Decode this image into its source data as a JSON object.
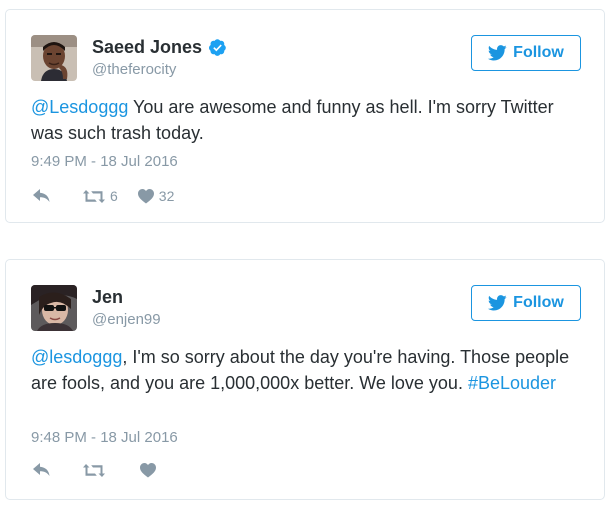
{
  "colors": {
    "link": "#1b95e0",
    "meta": "#8899a6",
    "text": "#292f33",
    "border": "#e1e8ed",
    "verified": "#1da1f2"
  },
  "follow_label": "Follow",
  "tweets": [
    {
      "display_name": "Saeed Jones",
      "verified": true,
      "handle": "@theferocity",
      "text_parts": [
        {
          "kind": "mention",
          "text": "@Lesdoggg"
        },
        {
          "kind": "text",
          "text": " You are awesome and funny as hell. I'm sorry Twitter was such trash today."
        }
      ],
      "timestamp": "9:49 PM - 18 Jul 2016",
      "retweet_count": "6",
      "like_count": "32",
      "icons": [
        "reply-icon",
        "retweet-icon",
        "heart-icon"
      ]
    },
    {
      "display_name": "Jen",
      "verified": false,
      "handle": "@enjen99",
      "text_parts": [
        {
          "kind": "mention",
          "text": "@lesdoggg"
        },
        {
          "kind": "text",
          "text": ", I'm so sorry about the day you're having. Those people are fools, and you are 1,000,000x better. We love you. "
        },
        {
          "kind": "hashtag",
          "text": "#BeLouder"
        }
      ],
      "timestamp": "9:48 PM - 18 Jul 2016",
      "retweet_count": "",
      "like_count": "",
      "icons": [
        "reply-icon",
        "retweet-icon",
        "heart-icon"
      ]
    }
  ]
}
